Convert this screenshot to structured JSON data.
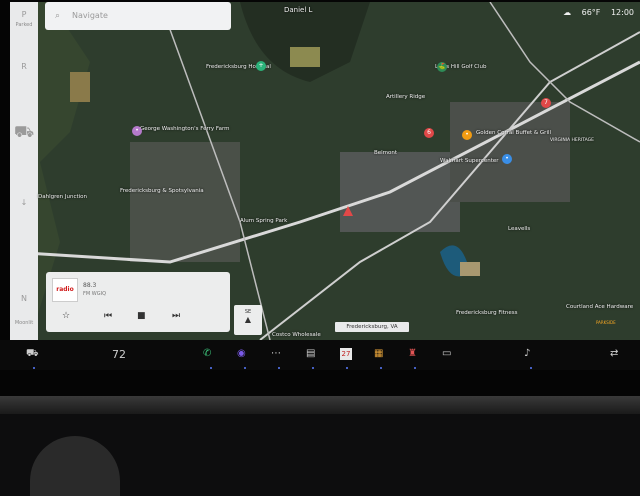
{
  "sidebar": {
    "items": [
      {
        "label": "P",
        "caption": "Parked"
      },
      {
        "label": "R"
      },
      {
        "label": "N"
      },
      {
        "label": "D"
      }
    ],
    "footer_caption": "Moonlit"
  },
  "navigation": {
    "placeholder": "Navigate"
  },
  "status": {
    "temperature": "66°F",
    "time": "12:00"
  },
  "map": {
    "labels": [
      "Daniel L",
      "Fredericksburg Hospital",
      "Lee's Hill Golf Club",
      "Artillery Ridge",
      "George Washington's Ferry Farm",
      "Fredericksburg & Spotsylvania",
      "Belmont",
      "Golden Corral Buffet & Grill",
      "Walmart Supercenter",
      "VIRGINIA HERITAGE",
      "Dahlgren Junction",
      "Alum Spring Park",
      "Leavells",
      "Courtland Ace Hardware",
      "Costco Wholesale",
      "Fredericksburg Fitness"
    ],
    "location_chip": "Fredericksburg, VA",
    "brand": "PARKSIDE"
  },
  "media": {
    "freq": "88.3",
    "station": "FM WGIQ",
    "logo": "radio",
    "controls": [
      "star",
      "prev",
      "stop",
      "next"
    ]
  },
  "compass": {
    "heading": "SE"
  },
  "taskbar": {
    "car": "car-icon",
    "temperature": "72",
    "apps": [
      "phone-icon",
      "camera-icon",
      "more-icon",
      "notes-icon",
      "calendar-icon",
      "apps-icon",
      "joystick-icon",
      "media-icon",
      "volume-icon",
      "swap-icon"
    ],
    "calendar_date": "27"
  }
}
